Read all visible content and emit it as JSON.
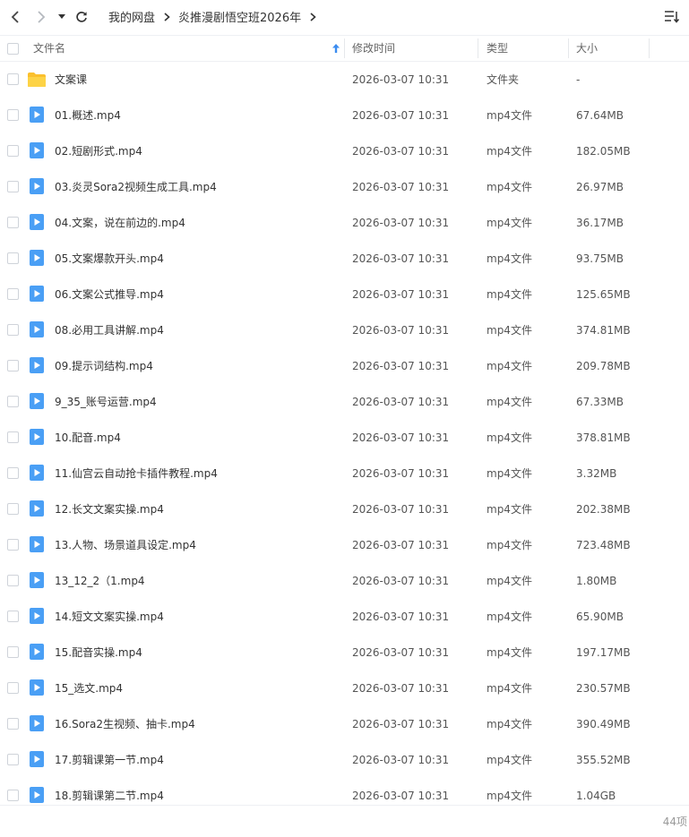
{
  "breadcrumb": [
    "我的网盘",
    "炎推漫剧悟空班2026年"
  ],
  "columns": {
    "name": "文件名",
    "modified": "修改时间",
    "type": "类型",
    "size": "大小"
  },
  "rows": [
    {
      "name": "文案课",
      "modified": "2026-03-07 10:31",
      "type": "文件夹",
      "size": "-",
      "icon": "folder-icon"
    },
    {
      "name": "01.概述.mp4",
      "modified": "2026-03-07 10:31",
      "type": "mp4文件",
      "size": "67.64MB",
      "icon": "video-file-icon"
    },
    {
      "name": "02.短剧形式.mp4",
      "modified": "2026-03-07 10:31",
      "type": "mp4文件",
      "size": "182.05MB",
      "icon": "video-file-icon"
    },
    {
      "name": "03.炎灵Sora2视频生成工具.mp4",
      "modified": "2026-03-07 10:31",
      "type": "mp4文件",
      "size": "26.97MB",
      "icon": "video-file-icon"
    },
    {
      "name": "04.文案，说在前边的.mp4",
      "modified": "2026-03-07 10:31",
      "type": "mp4文件",
      "size": "36.17MB",
      "icon": "video-file-icon"
    },
    {
      "name": "05.文案爆款开头.mp4",
      "modified": "2026-03-07 10:31",
      "type": "mp4文件",
      "size": "93.75MB",
      "icon": "video-file-icon"
    },
    {
      "name": "06.文案公式推导.mp4",
      "modified": "2026-03-07 10:31",
      "type": "mp4文件",
      "size": "125.65MB",
      "icon": "video-file-icon"
    },
    {
      "name": "08.必用工具讲解.mp4",
      "modified": "2026-03-07 10:31",
      "type": "mp4文件",
      "size": "374.81MB",
      "icon": "video-file-icon"
    },
    {
      "name": "09.提示词结构.mp4",
      "modified": "2026-03-07 10:31",
      "type": "mp4文件",
      "size": "209.78MB",
      "icon": "video-file-icon"
    },
    {
      "name": "9_35_账号运营.mp4",
      "modified": "2026-03-07 10:31",
      "type": "mp4文件",
      "size": "67.33MB",
      "icon": "video-file-icon"
    },
    {
      "name": "10.配音.mp4",
      "modified": "2026-03-07 10:31",
      "type": "mp4文件",
      "size": "378.81MB",
      "icon": "video-file-icon"
    },
    {
      "name": "11.仙宫云自动抢卡插件教程.mp4",
      "modified": "2026-03-07 10:31",
      "type": "mp4文件",
      "size": "3.32MB",
      "icon": "video-file-icon"
    },
    {
      "name": "12.长文文案实操.mp4",
      "modified": "2026-03-07 10:31",
      "type": "mp4文件",
      "size": "202.38MB",
      "icon": "video-file-icon"
    },
    {
      "name": "13.人物、场景道具设定.mp4",
      "modified": "2026-03-07 10:31",
      "type": "mp4文件",
      "size": "723.48MB",
      "icon": "video-file-icon"
    },
    {
      "name": "13_12_2（1.mp4",
      "modified": "2026-03-07 10:31",
      "type": "mp4文件",
      "size": "1.80MB",
      "icon": "video-file-icon"
    },
    {
      "name": "14.短文文案实操.mp4",
      "modified": "2026-03-07 10:31",
      "type": "mp4文件",
      "size": "65.90MB",
      "icon": "video-file-icon"
    },
    {
      "name": "15.配音实操.mp4",
      "modified": "2026-03-07 10:31",
      "type": "mp4文件",
      "size": "197.17MB",
      "icon": "video-file-icon"
    },
    {
      "name": "15_选文.mp4",
      "modified": "2026-03-07 10:31",
      "type": "mp4文件",
      "size": "230.57MB",
      "icon": "video-file-icon"
    },
    {
      "name": "16.Sora2生视频、抽卡.mp4",
      "modified": "2026-03-07 10:31",
      "type": "mp4文件",
      "size": "390.49MB",
      "icon": "video-file-icon"
    },
    {
      "name": "17.剪辑课第一节.mp4",
      "modified": "2026-03-07 10:31",
      "type": "mp4文件",
      "size": "355.52MB",
      "icon": "video-file-icon"
    },
    {
      "name": "18.剪辑课第二节.mp4",
      "modified": "2026-03-07 10:31",
      "type": "mp4文件",
      "size": "1.04GB",
      "icon": "video-file-icon"
    }
  ],
  "footer": {
    "count": "44项"
  },
  "colors": {
    "accent": "#3b8cf0",
    "folder": "#fbc02d",
    "video": "#4a9ff5"
  }
}
